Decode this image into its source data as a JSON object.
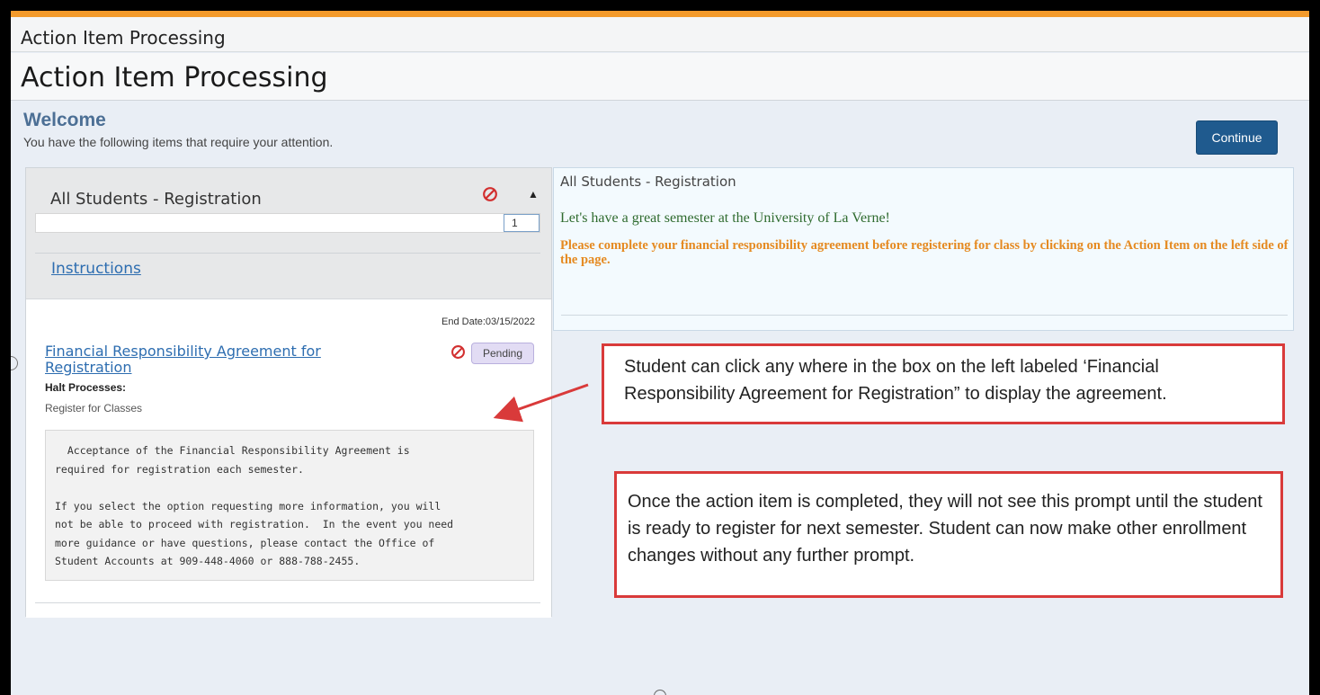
{
  "breadcrumb": "Action Item Processing",
  "page_title": "Action Item Processing",
  "welcome": {
    "heading": "Welcome",
    "subtitle": "You have the following items that require your attention."
  },
  "continue_label": "Continue",
  "group": {
    "title": "All Students - Registration",
    "status_icon": "stop-icon",
    "collapse_icon": "caret-up-icon",
    "progress_value": "1",
    "instructions_label": "Instructions"
  },
  "item": {
    "end_date": "End Date:03/15/2022",
    "title": "Financial Responsibility Agreement for Registration",
    "status": "Pending",
    "halt_label": "Halt Processes:",
    "halt_value": "Register for Classes",
    "description": "  Acceptance of the Financial Responsibility Agreement is\nrequired for registration each semester.\n\nIf you select the option requesting more information, you will\nnot be able to proceed with registration.  In the event you need\nmore guidance or have questions, please contact the Office of\nStudent Accounts at 909-448-4060 or 888-788-2455."
  },
  "right_panel": {
    "title": "All Students - Registration",
    "message_green": "Let's have a great semester at the University of La Verne!",
    "message_orange": "Please complete your financial responsibility agreement before registering for class by clicking on the Action Item on the left side of the page."
  },
  "annotations": {
    "callout_1": "Student can click any where in the box on the left labeled ‘Financial Responsibility Agreement for Registration” to display the agreement.",
    "callout_2": "Once the action item is completed, they will not see this prompt until the student is ready to register for next semester. Student can now make other enrollment changes without any further prompt."
  },
  "colors": {
    "accent_orange": "#f39a2b",
    "button_blue": "#1f5a8e",
    "link_blue": "#2d6db0",
    "callout_red": "#d93a3a",
    "message_green": "#2f6b2f",
    "message_orange": "#e58a21",
    "pending_bg": "#e2dcf4"
  }
}
